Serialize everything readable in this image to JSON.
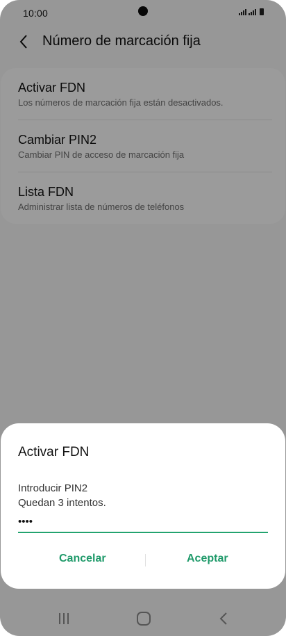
{
  "status_bar": {
    "time": "10:00"
  },
  "header": {
    "title": "Número de marcación fija"
  },
  "settings_list": [
    {
      "title": "Activar FDN",
      "subtitle": "Los números de marcación fija están desactivados."
    },
    {
      "title": "Cambiar PIN2",
      "subtitle": "Cambiar PIN de acceso de marcación fija"
    },
    {
      "title": "Lista FDN",
      "subtitle": "Administrar lista de números de teléfonos"
    }
  ],
  "dialog": {
    "title": "Activar FDN",
    "prompt": "Introducir PIN2",
    "attempts": "Quedan 3 intentos.",
    "pin_value": "••••",
    "cancel_label": "Cancelar",
    "ok_label": "Aceptar"
  },
  "colors": {
    "accent": "#1f9a6a",
    "scrim": "rgba(0,0,0,0.38)"
  },
  "icons": {
    "back": "chevron-left-icon",
    "nav_recents": "recents-icon",
    "nav_home": "home-icon",
    "nav_back": "back-icon"
  }
}
